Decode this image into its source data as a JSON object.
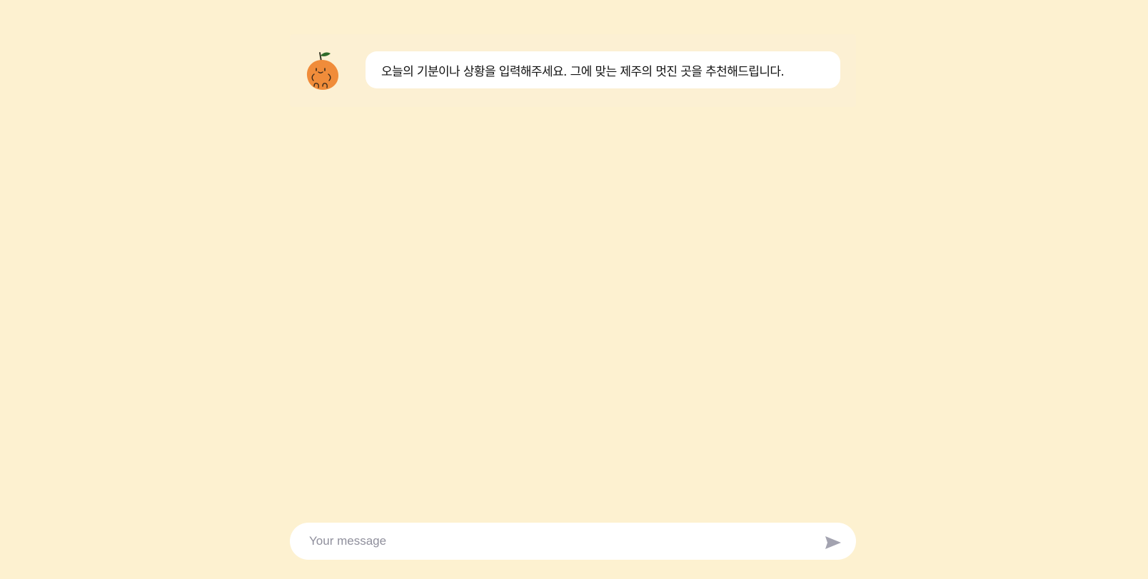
{
  "chat": {
    "messages": [
      {
        "sender": "bot",
        "avatar_icon": "tangerine-mascot-icon",
        "text": "오늘의 기분이나 상황을 입력해주세요. 그에 맞는 제주의 멋진 곳을 추천해드립니다."
      }
    ]
  },
  "composer": {
    "placeholder": "Your message",
    "value": "",
    "send_icon": "send-icon"
  },
  "colors": {
    "background": "#fdf1d0",
    "bubble": "#ffffff",
    "tangerine": "#f08c3a",
    "leaf": "#2f6b2a",
    "send_icon": "#a3a3b0"
  }
}
